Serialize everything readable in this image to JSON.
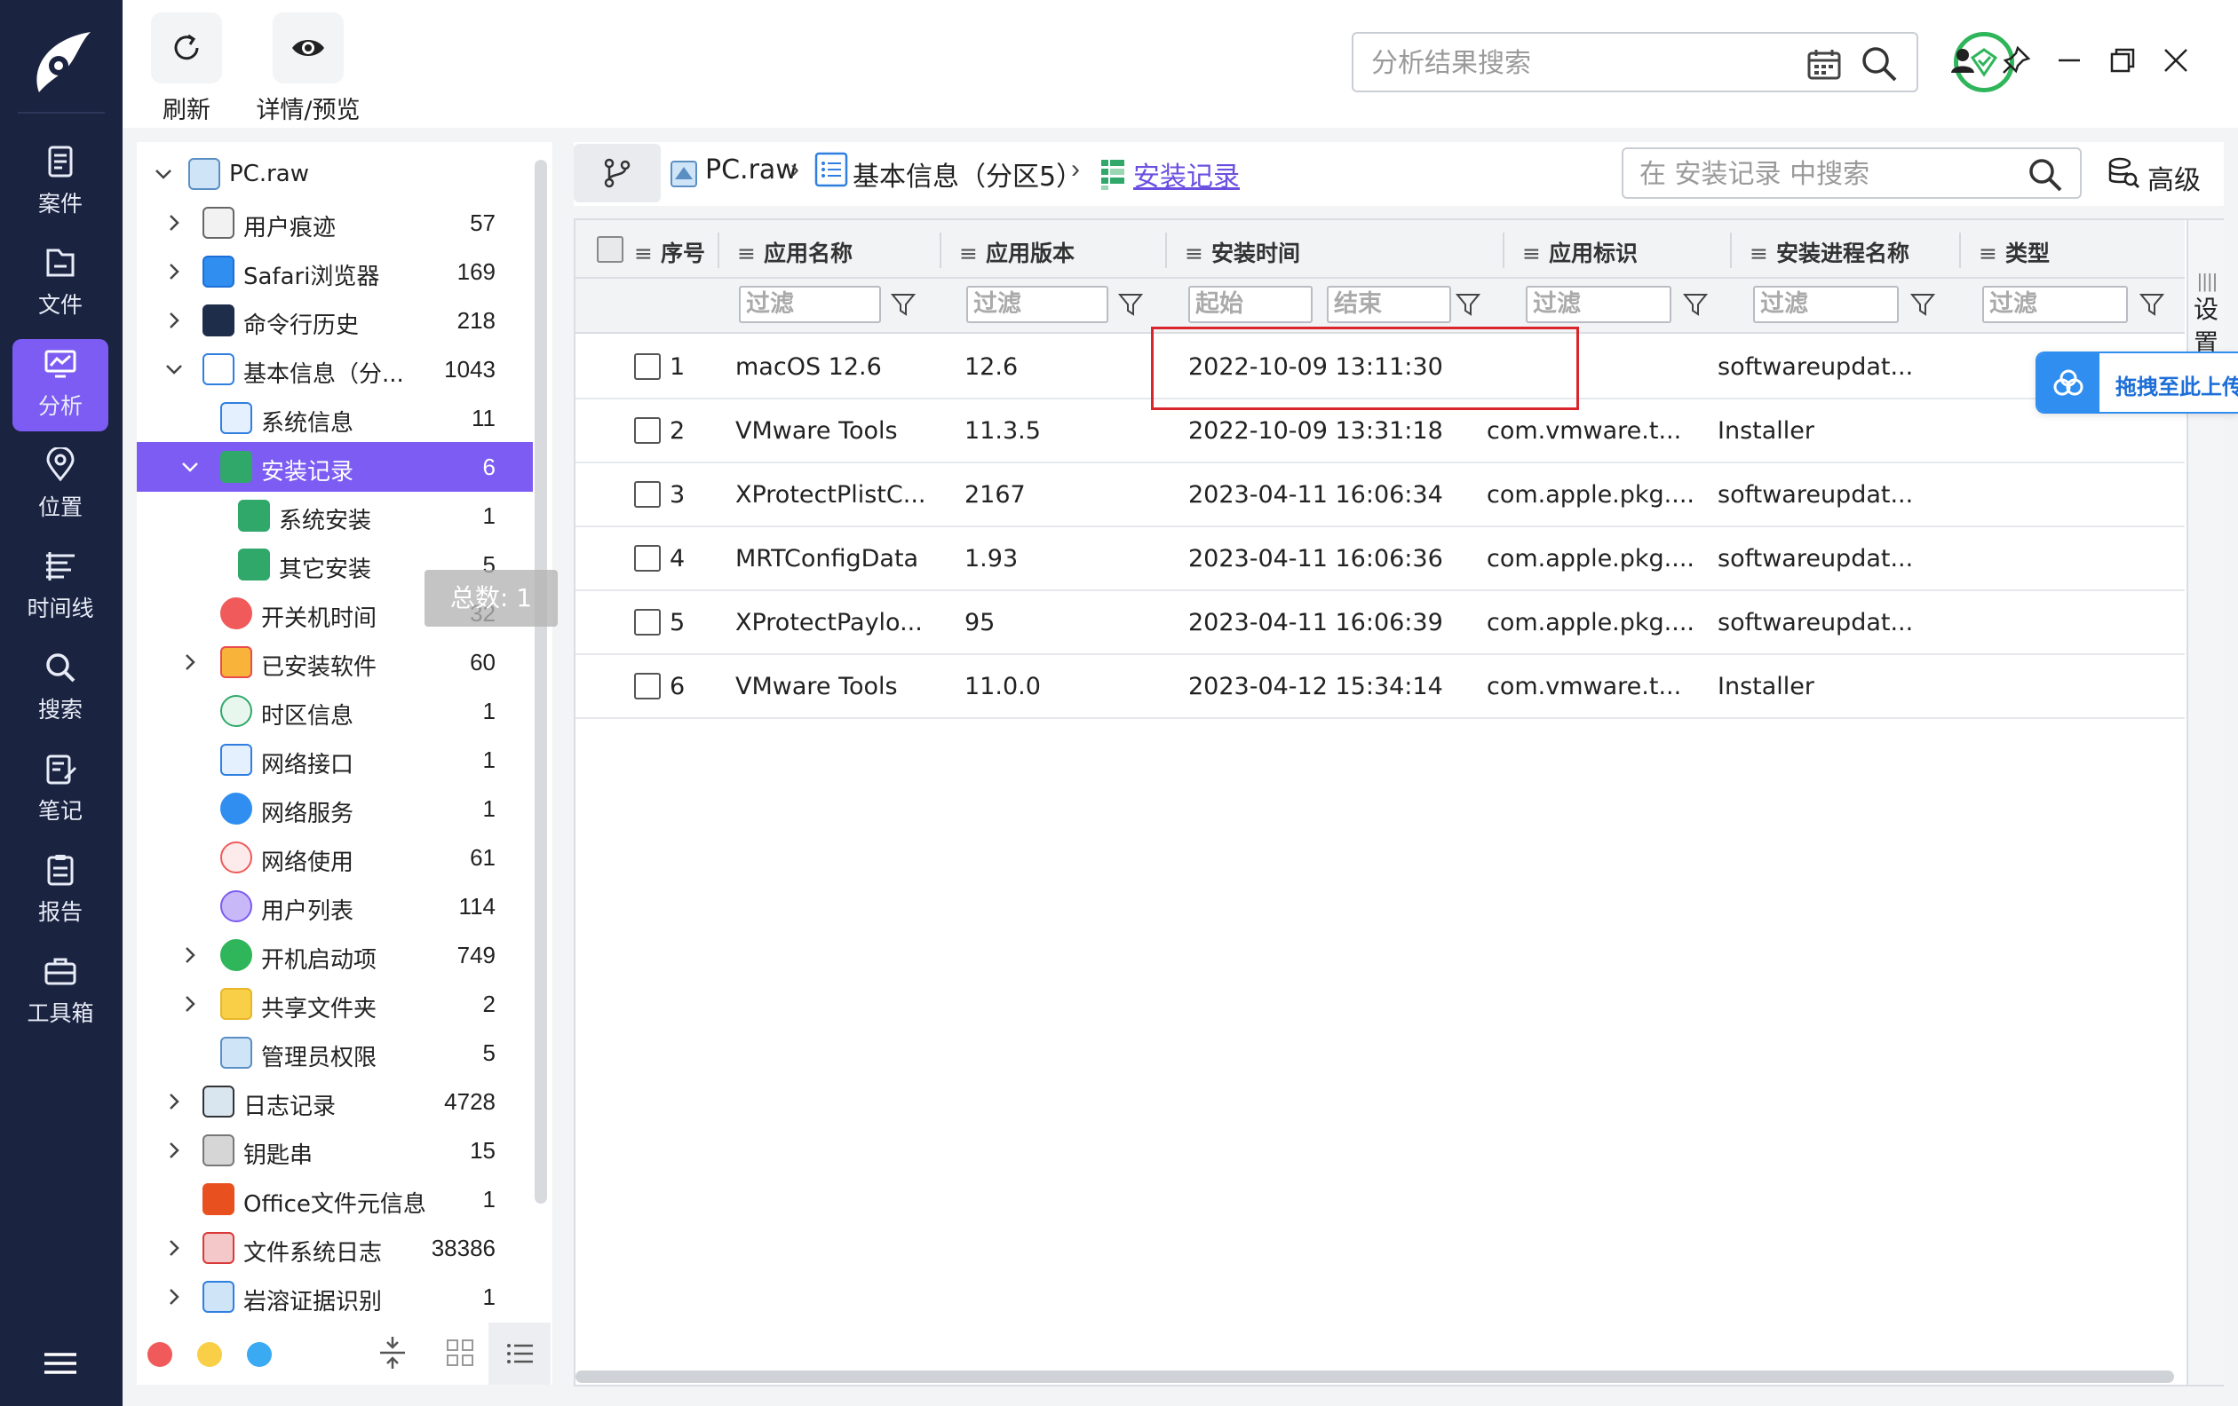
{
  "nav": {
    "items": [
      {
        "label": "案件",
        "icon": "case-icon"
      },
      {
        "label": "文件",
        "icon": "file-icon"
      },
      {
        "label": "分析",
        "icon": "analysis-icon",
        "active": true
      },
      {
        "label": "位置",
        "icon": "location-icon"
      },
      {
        "label": "时间线",
        "icon": "timeline-icon"
      },
      {
        "label": "搜索",
        "icon": "search-icon"
      },
      {
        "label": "笔记",
        "icon": "notes-icon"
      },
      {
        "label": "报告",
        "icon": "report-icon"
      },
      {
        "label": "工具箱",
        "icon": "toolbox-icon"
      }
    ]
  },
  "toolbar": {
    "refresh_label": "刷新",
    "detail_label": "详情/预览",
    "search_placeholder": "分析结果搜索"
  },
  "tree": {
    "items": [
      {
        "label": "PC.raw",
        "count": ""
      },
      {
        "label": "用户痕迹",
        "count": "57"
      },
      {
        "label": "Safari浏览器",
        "count": "169"
      },
      {
        "label": "命令行历史",
        "count": "218"
      },
      {
        "label": "基本信息（分...",
        "count": "1043"
      },
      {
        "label": "系统信息",
        "count": "11"
      },
      {
        "label": "安装记录",
        "count": "6"
      },
      {
        "label": "系统安装",
        "count": "1"
      },
      {
        "label": "其它安装",
        "count": "5"
      },
      {
        "label": "开关机时间",
        "count": "32"
      },
      {
        "label": "已安装软件",
        "count": "60"
      },
      {
        "label": "时区信息",
        "count": "1"
      },
      {
        "label": "网络接口",
        "count": "1"
      },
      {
        "label": "网络服务",
        "count": "1"
      },
      {
        "label": "网络使用",
        "count": "61"
      },
      {
        "label": "用户列表",
        "count": "114"
      },
      {
        "label": "开机启动项",
        "count": "749"
      },
      {
        "label": "共享文件夹",
        "count": "2"
      },
      {
        "label": "管理员权限",
        "count": "5"
      },
      {
        "label": "日志记录",
        "count": "4728"
      },
      {
        "label": "钥匙串",
        "count": "15"
      },
      {
        "label": "Office文件元信息",
        "count": "1"
      },
      {
        "label": "文件系统日志",
        "count": "38386"
      },
      {
        "label": "岩溶证据识别",
        "count": "1"
      }
    ],
    "tooltip": "总数: 1"
  },
  "breadcrumb": {
    "root": "PC.raw",
    "partition": "基本信息（分区5）",
    "current": "安装记录",
    "search_placeholder": "在 安装记录 中搜索",
    "advanced_label": "高级"
  },
  "table": {
    "columns": [
      "序号",
      "应用名称",
      "应用版本",
      "安装时间",
      "应用标识",
      "安装进程名称",
      "类型"
    ],
    "filter_placeholder": "过滤",
    "filter_start": "起始",
    "filter_end": "结束",
    "rows": [
      {
        "no": "1",
        "name": "macOS 12.6",
        "version": "12.6",
        "time": "2022-10-09 13:11:30",
        "id": "",
        "process": "softwareupdat..."
      },
      {
        "no": "2",
        "name": "VMware Tools",
        "version": "11.3.5",
        "time": "2022-10-09 13:31:18",
        "id": "com.vmware.t...",
        "process": "Installer"
      },
      {
        "no": "3",
        "name": "XProtectPlistC...",
        "version": "2167",
        "time": "2023-04-11 16:06:34",
        "id": "com.apple.pkg....",
        "process": "softwareupdat..."
      },
      {
        "no": "4",
        "name": "MRTConfigData",
        "version": "1.93",
        "time": "2023-04-11 16:06:36",
        "id": "com.apple.pkg....",
        "process": "softwareupdat..."
      },
      {
        "no": "5",
        "name": "XProtectPaylo...",
        "version": "95",
        "time": "2023-04-11 16:06:39",
        "id": "com.apple.pkg....",
        "process": "softwareupdat..."
      },
      {
        "no": "6",
        "name": "VMware Tools",
        "version": "11.0.0",
        "time": "2023-04-12 15:34:14",
        "id": "com.vmware.t...",
        "process": "Installer"
      }
    ]
  },
  "side": {
    "settings_label": "设置",
    "upload_label": "拖拽至此上传"
  },
  "colors": {
    "accent": "#7c5cf2",
    "nav_bg": "#1a2340",
    "highlight": "#d9262c",
    "status_ok": "#2fb55a"
  }
}
